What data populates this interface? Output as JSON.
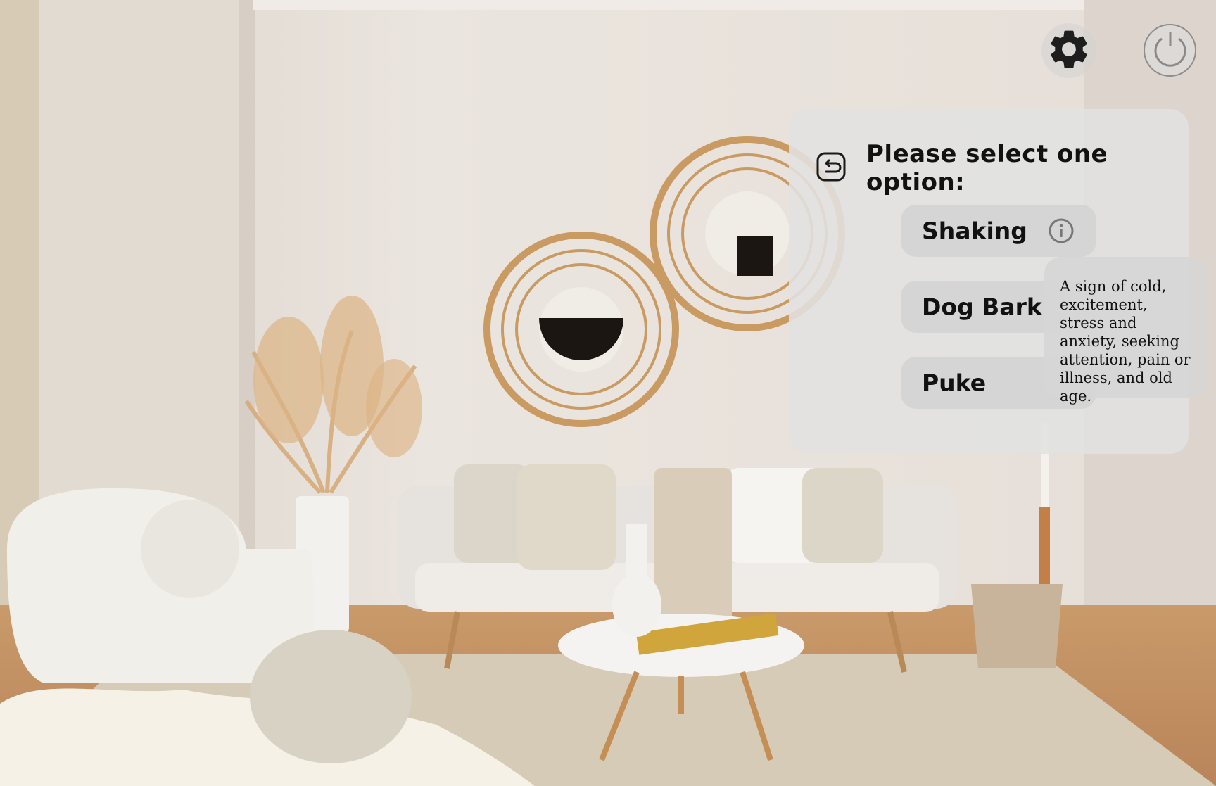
{
  "colors": {
    "panel_bg": "#e1e1e1",
    "option_bg": "#d2d2d2",
    "text": "#111111",
    "icon_dark": "#222222"
  },
  "topbar": {
    "settings_icon": "gear-icon",
    "power_icon": "power-icon"
  },
  "panel": {
    "back_icon": "back-arrow-icon",
    "title": "Please select one option:",
    "options": [
      {
        "label": "Shaking",
        "info_icon": "info-icon"
      },
      {
        "label": "Dog Bark"
      },
      {
        "label": "Puke"
      }
    ]
  },
  "tooltip": {
    "text": "A sign of cold, excitement, stress and anxiety, seeking attention, pain or illness, and old age."
  }
}
